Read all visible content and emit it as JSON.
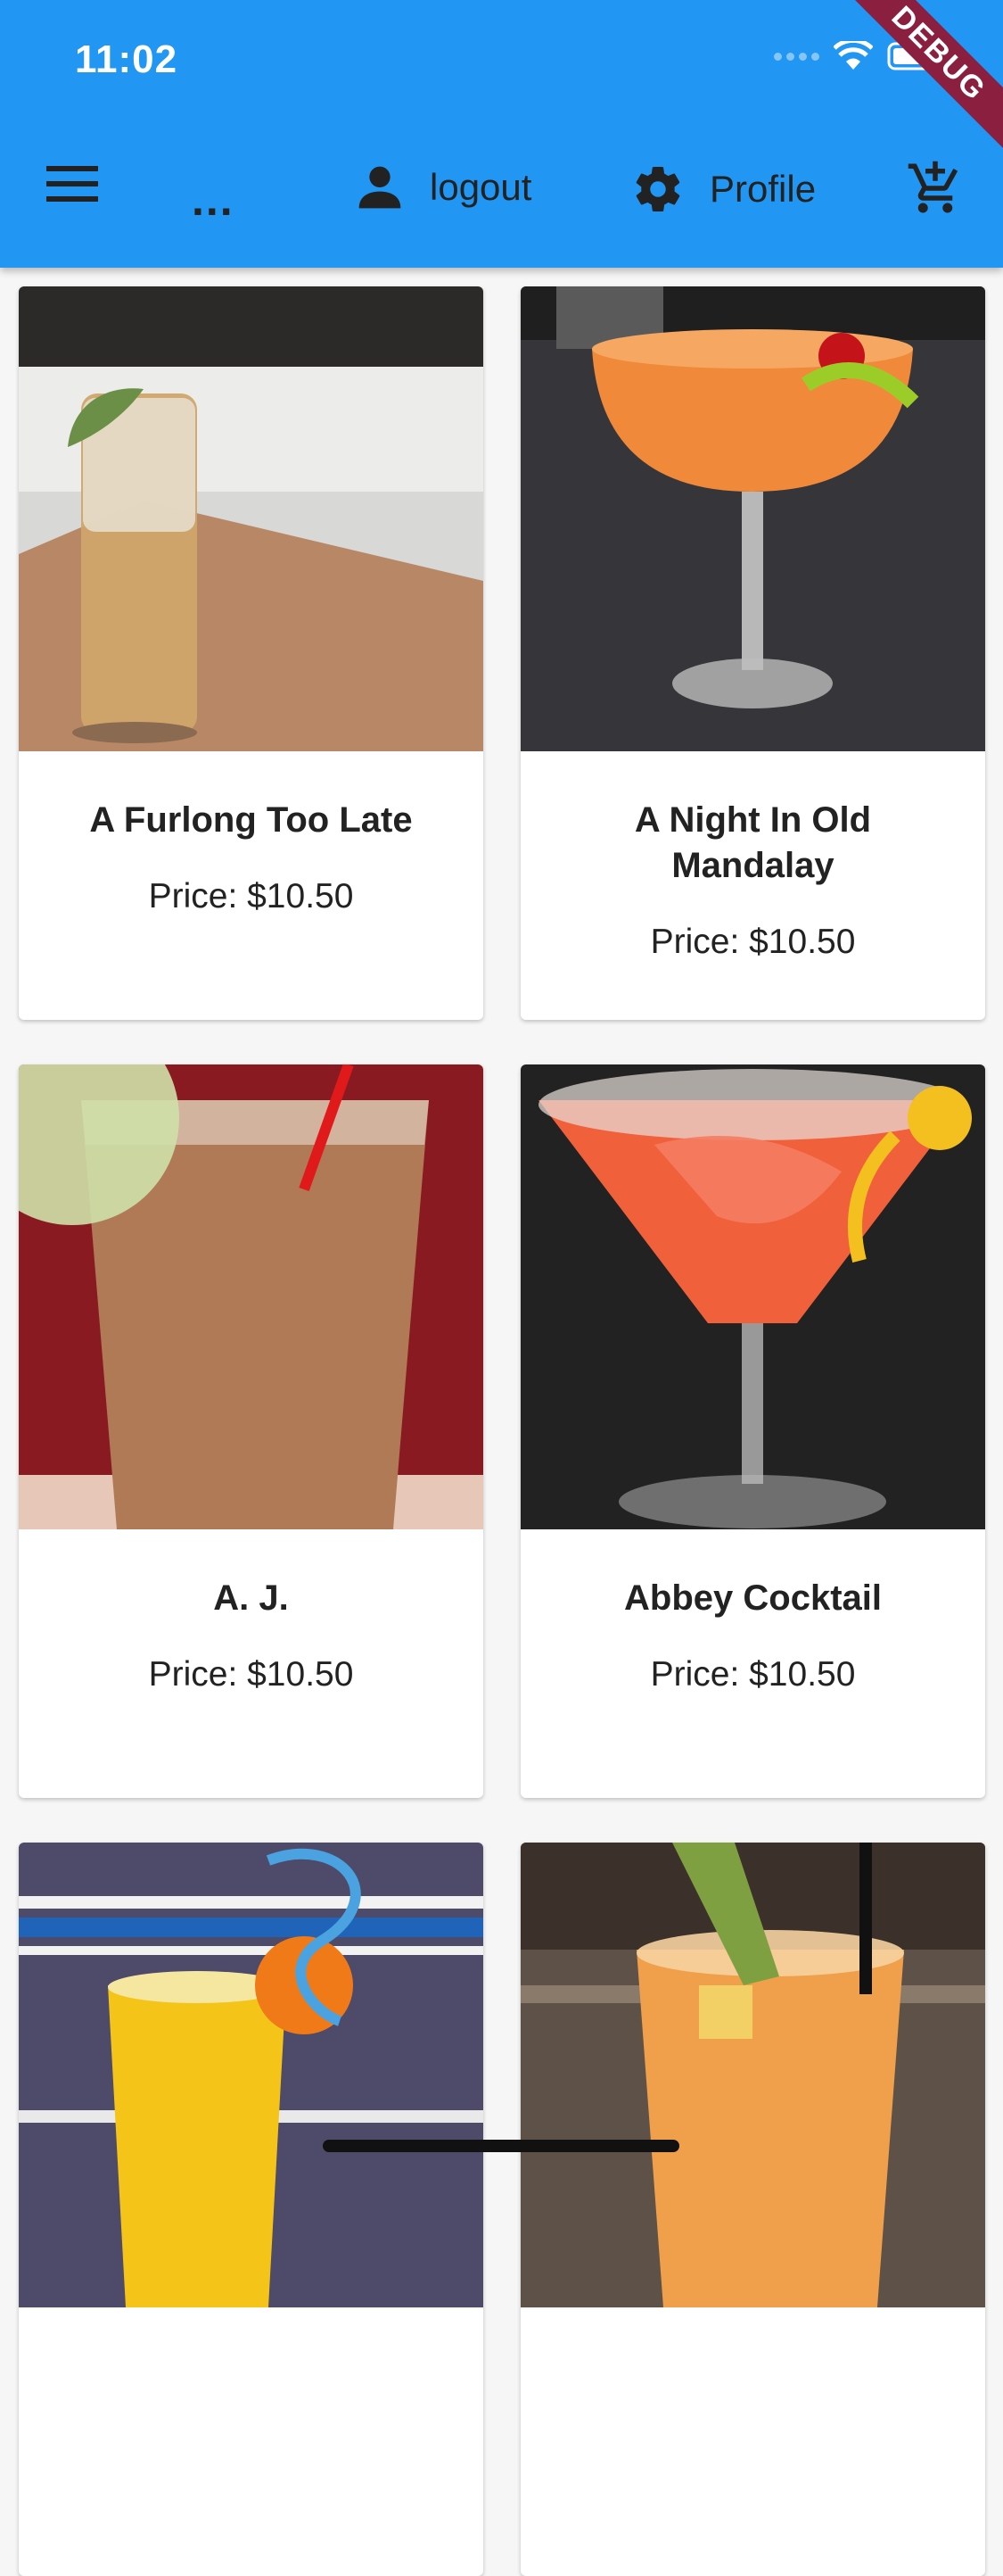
{
  "status_bar": {
    "time": "11:02"
  },
  "debug_banner": "DEBUG",
  "toolbar": {
    "menu_icon": "hamburger-menu-icon",
    "more_label": "...",
    "logout_label": "logout",
    "profile_label": "Profile",
    "cart_icon": "add-shopping-cart-icon"
  },
  "colors": {
    "app_bar": "#2196f3",
    "background": "#f6f6f6",
    "card": "#ffffff",
    "debug_ribbon": "#8b1f3f"
  },
  "products": [
    {
      "name": "A Furlong Too Late",
      "price": "Price: $10.50"
    },
    {
      "name": "A Night In Old Mandalay",
      "price": "Price: $10.50"
    },
    {
      "name": "A. J.",
      "price": "Price: $10.50"
    },
    {
      "name": "Abbey Cocktail",
      "price": "Price: $10.50"
    },
    {
      "name": "",
      "price": ""
    },
    {
      "name": "",
      "price": ""
    }
  ]
}
